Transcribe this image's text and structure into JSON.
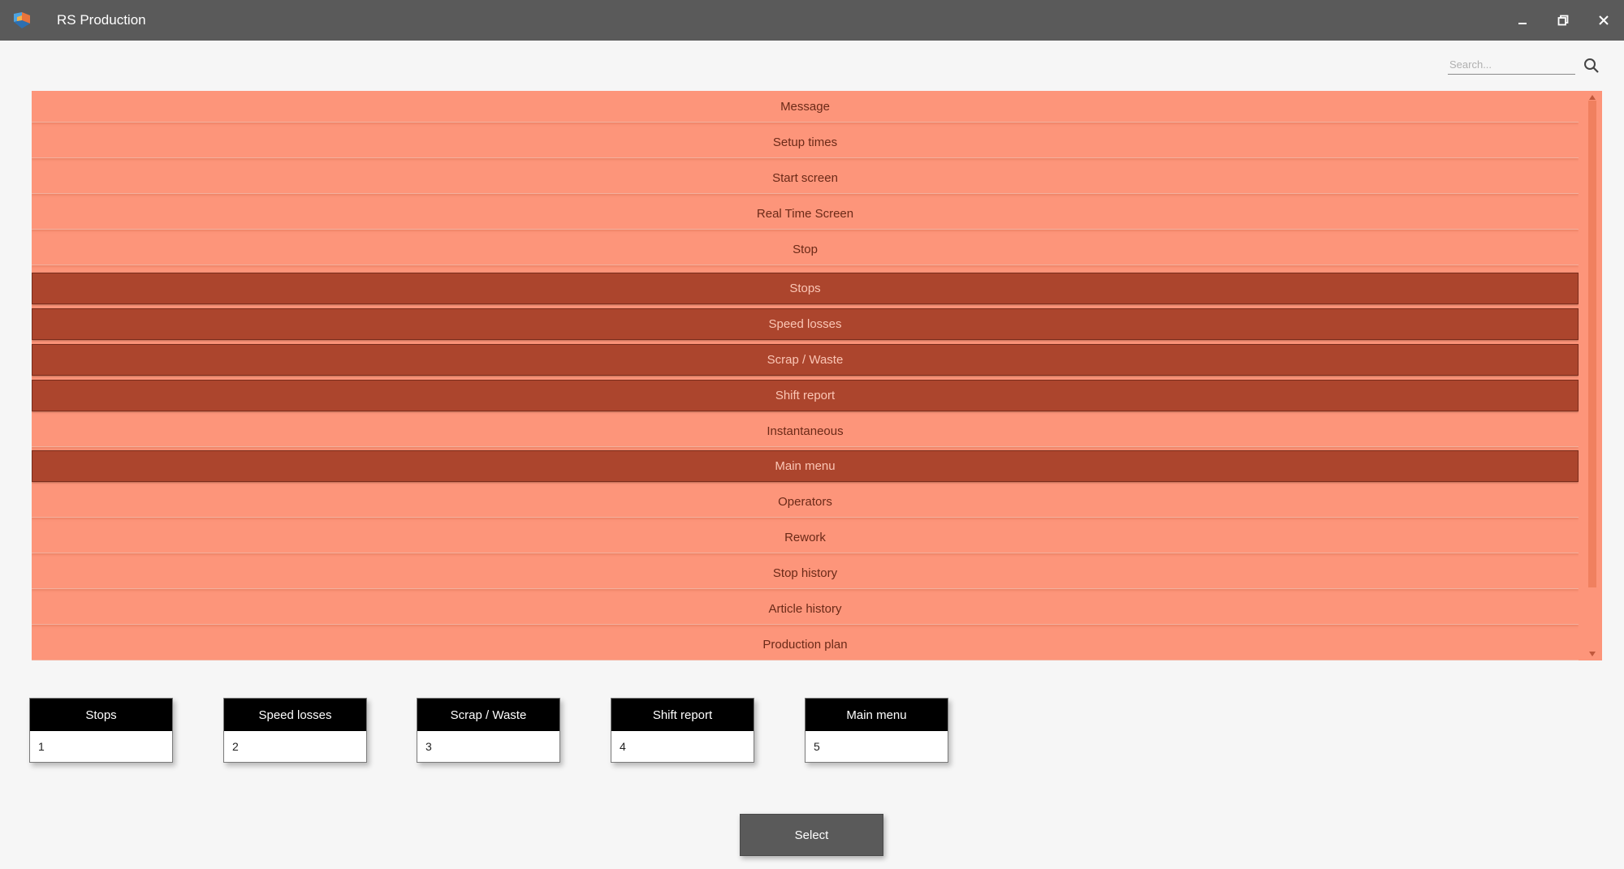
{
  "window": {
    "title": "RS Production",
    "icon": "app-logo-icon",
    "controls": [
      "minimize-icon",
      "restore-icon",
      "close-icon"
    ]
  },
  "search": {
    "placeholder": "Search...",
    "value": "",
    "icon": "search-icon"
  },
  "list": {
    "items": [
      {
        "label": "Message",
        "selected": false
      },
      {
        "label": "Setup times",
        "selected": false
      },
      {
        "label": "Start screen",
        "selected": false
      },
      {
        "label": "Real Time Screen",
        "selected": false
      },
      {
        "label": "Stop",
        "selected": false
      },
      {
        "label": "Stops",
        "selected": true
      },
      {
        "label": "Speed losses",
        "selected": true
      },
      {
        "label": "Scrap / Waste",
        "selected": true
      },
      {
        "label": "Shift report",
        "selected": true
      },
      {
        "label": "Instantaneous",
        "selected": false
      },
      {
        "label": "Main menu",
        "selected": true
      },
      {
        "label": "Operators",
        "selected": false
      },
      {
        "label": "Rework",
        "selected": false
      },
      {
        "label": "Stop history",
        "selected": false
      },
      {
        "label": "Article history",
        "selected": false
      },
      {
        "label": "Production plan",
        "selected": false
      }
    ]
  },
  "selection_cards": [
    {
      "label": "Stops",
      "number": "1"
    },
    {
      "label": "Speed losses",
      "number": "2"
    },
    {
      "label": "Scrap / Waste",
      "number": "3"
    },
    {
      "label": "Shift report",
      "number": "4"
    },
    {
      "label": "Main menu",
      "number": "5"
    }
  ],
  "actions": {
    "select_label": "Select"
  },
  "colors": {
    "titlebar": "#5a5a5a",
    "item": "#fd957a",
    "item_selected": "#ac452d",
    "item_text": "#6b2a18",
    "item_selected_text": "#fbc6b5",
    "card_header": "#000000",
    "button": "#5a5a5a"
  }
}
